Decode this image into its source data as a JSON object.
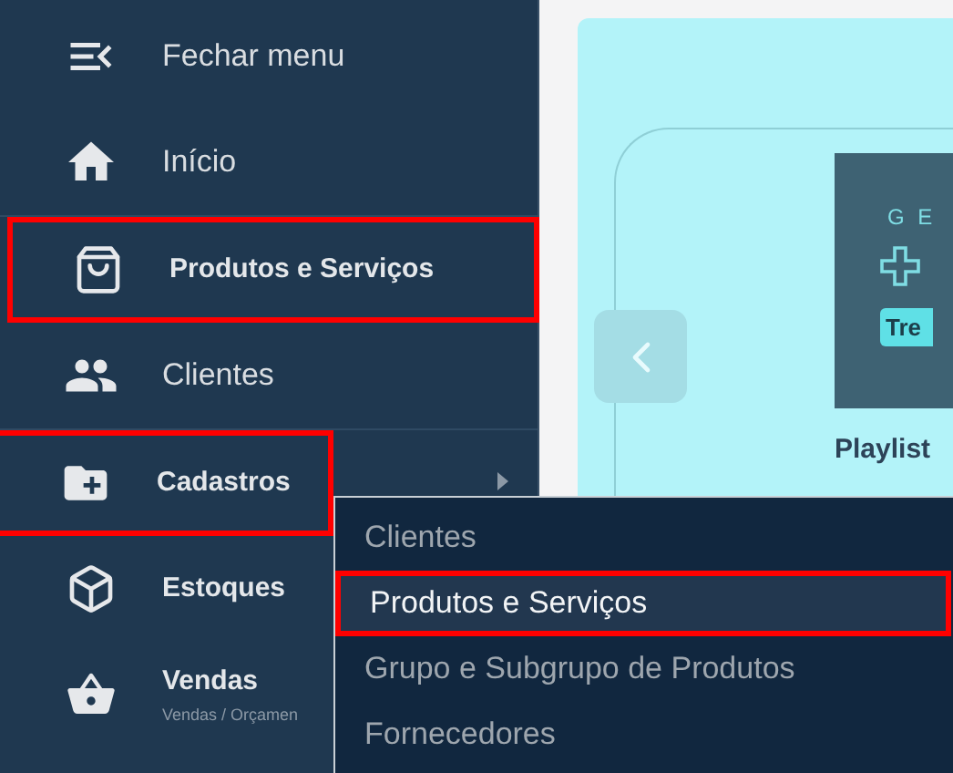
{
  "sidebar": {
    "items": [
      {
        "label": "Fechar menu",
        "kind": "plain",
        "highlighted": false,
        "has_submenu": false
      },
      {
        "label": "Início",
        "kind": "plain",
        "highlighted": false,
        "has_submenu": false
      },
      {
        "label": "Produtos e Serviços",
        "kind": "module",
        "highlighted": true,
        "has_submenu": false
      },
      {
        "label": "Clientes",
        "kind": "plain",
        "highlighted": false,
        "has_submenu": false
      },
      {
        "label": "Cadastros",
        "kind": "module",
        "highlighted": true,
        "has_submenu": true
      },
      {
        "label": "Estoques",
        "kind": "module",
        "highlighted": false,
        "has_submenu": false
      },
      {
        "label": "Vendas",
        "subtitle": "Vendas / Orçamen",
        "kind": "module",
        "highlighted": false,
        "has_submenu": false
      }
    ]
  },
  "submenu": {
    "items": [
      {
        "label": "Clientes",
        "selected": false
      },
      {
        "label": "Produtos e Serviços",
        "selected": true
      },
      {
        "label": "Grupo e Subgrupo de Produtos",
        "selected": false
      },
      {
        "label": "Fornecedores",
        "selected": false
      }
    ]
  },
  "carousel": {
    "logo_text": "G E",
    "badge": "Tre",
    "caption": "Playlist"
  }
}
